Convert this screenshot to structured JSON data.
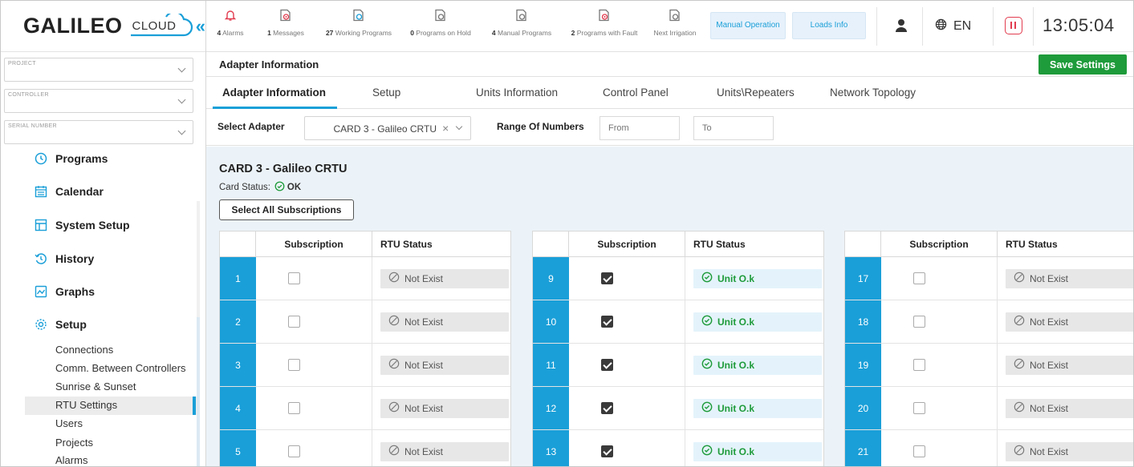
{
  "brand": {
    "name": "GALILEO",
    "cloud": "CLOUD",
    "collapse": "«"
  },
  "selectors": {
    "project_label": "PROJECT",
    "controller_label": "CONTROLLER",
    "serial_label": "SERIAL NUMBER"
  },
  "nav": {
    "programs": "Programs",
    "calendar": "Calendar",
    "system_setup": "System Setup",
    "history": "History",
    "graphs": "Graphs",
    "setup": "Setup",
    "sub": [
      "Connections",
      "Comm. Between Controllers",
      "Sunrise & Sunset",
      "RTU Settings",
      "Users",
      "Projects",
      "Alarms"
    ]
  },
  "topbar": {
    "stats": [
      {
        "count": "4",
        "label": "Alarms",
        "icon": "bell-icon"
      },
      {
        "count": "1",
        "label": "Messages",
        "icon": "message-icon"
      },
      {
        "count": "27",
        "label": "Working Programs",
        "icon": "working-program-icon"
      },
      {
        "count": "0",
        "label": "Programs on Hold",
        "icon": "hold-program-icon"
      },
      {
        "count": "4",
        "label": "Manual Programs",
        "icon": "manual-program-icon"
      },
      {
        "count": "2",
        "label": "Programs with Fault",
        "icon": "fault-program-icon"
      },
      {
        "count": "",
        "label": "Next Irrigation",
        "icon": "next-irrigation-icon"
      }
    ],
    "manual_operation": "Manual Operation",
    "loads_info": "Loads Info",
    "language": "EN",
    "clock": "13:05:04"
  },
  "page": {
    "title": "Adapter Information",
    "save": "Save Settings",
    "tabs": [
      "Adapter Information",
      "Setup",
      "Units Information",
      "Control Panel",
      "Units\\Repeaters",
      "Network Topology"
    ],
    "select_adapter_label": "Select Adapter",
    "adapter_value": "CARD 3 - Galileo CRTU",
    "range_label": "Range Of Numbers",
    "from_placeholder": "From",
    "to_placeholder": "To"
  },
  "card": {
    "title": "CARD 3 - Galileo CRTU",
    "status_label": "Card Status:",
    "status_value": "OK",
    "select_all": "Select All Subscriptions"
  },
  "table": {
    "col_subscription": "Subscription",
    "col_status": "RTU Status",
    "groups": [
      [
        {
          "num": "1",
          "checked": false,
          "status": "Not Exist",
          "ok": false
        },
        {
          "num": "2",
          "checked": false,
          "status": "Not Exist",
          "ok": false
        },
        {
          "num": "3",
          "checked": false,
          "status": "Not Exist",
          "ok": false
        },
        {
          "num": "4",
          "checked": false,
          "status": "Not Exist",
          "ok": false
        },
        {
          "num": "5",
          "checked": false,
          "status": "Not Exist",
          "ok": false
        }
      ],
      [
        {
          "num": "9",
          "checked": true,
          "status": "Unit O.k",
          "ok": true
        },
        {
          "num": "10",
          "checked": true,
          "status": "Unit O.k",
          "ok": true
        },
        {
          "num": "11",
          "checked": true,
          "status": "Unit O.k",
          "ok": true
        },
        {
          "num": "12",
          "checked": true,
          "status": "Unit O.k",
          "ok": true
        },
        {
          "num": "13",
          "checked": true,
          "status": "Unit O.k",
          "ok": true
        }
      ],
      [
        {
          "num": "17",
          "checked": false,
          "status": "Not Exist",
          "ok": false
        },
        {
          "num": "18",
          "checked": false,
          "status": "Not Exist",
          "ok": false
        },
        {
          "num": "19",
          "checked": false,
          "status": "Not Exist",
          "ok": false
        },
        {
          "num": "20",
          "checked": false,
          "status": "Not Exist",
          "ok": false
        },
        {
          "num": "21",
          "checked": false,
          "status": "Not Exist",
          "ok": false
        }
      ]
    ]
  },
  "colors": {
    "accent": "#1a9fd8",
    "save": "#1e9b3a",
    "ok": "#1e9b3a",
    "alert": "#e23c4f"
  }
}
